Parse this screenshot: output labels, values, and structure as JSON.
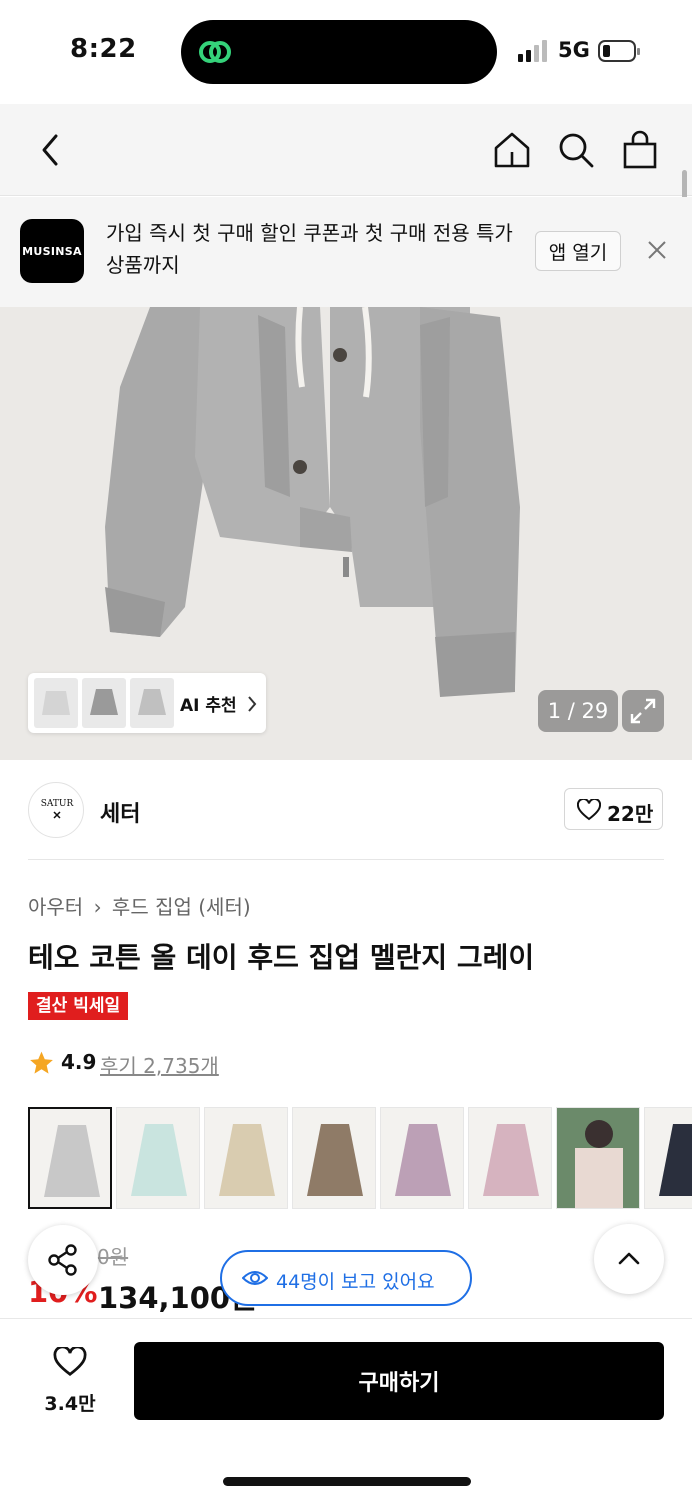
{
  "status_bar": {
    "time": "8:22",
    "network": "5G"
  },
  "banner": {
    "logo_text": "MUSINSA",
    "text": "가입 즉시 첫 구매 할인 쿠폰과 첫 구매 전용 특가 상품까지",
    "open_app_label": "앱 열기"
  },
  "gallery": {
    "ai_label": "AI 추천",
    "counter": "1 / 29"
  },
  "brand": {
    "logo_text": "SATUR",
    "name": "세터",
    "likes": "22만"
  },
  "breadcrumb": {
    "category": "아우터",
    "subcategory": "후드 집업 (세터)"
  },
  "product": {
    "title": "테오 코튼 올 데이 후드 집업 멜란지 그레이",
    "sale_tag": "결산 빅세일",
    "rating": "4.9",
    "reviews": "후기 2,735개",
    "original_price_partial": "0원",
    "discount_partial": "10%",
    "price_partial": "134,100원"
  },
  "swatch_colors": [
    "#c8c8c8",
    "#c9e4df",
    "#d9ccb0",
    "#8f7b67",
    "#bca0b6",
    "#d6b3bf",
    "#e8d9d2",
    "#2a2f3d"
  ],
  "viewers_text": "44명이 보고 있어요",
  "bottom": {
    "wish_count": "3.4만",
    "buy_label": "구매하기"
  },
  "colors": {
    "accent_blue": "#1f6fe5",
    "sale_red": "#e01e1e",
    "star": "#f5a623",
    "island_green": "#35d27a"
  }
}
